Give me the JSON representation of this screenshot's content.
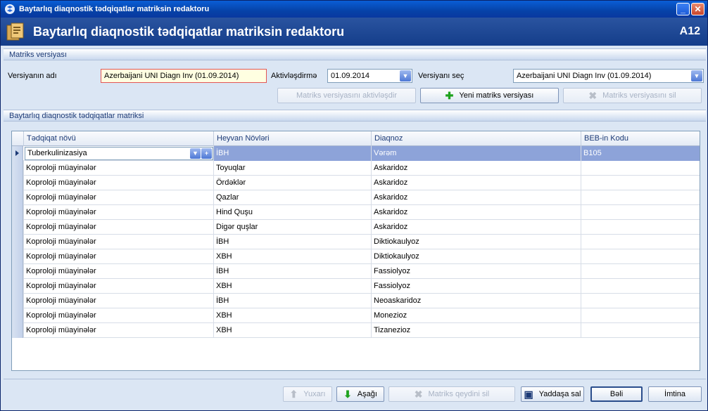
{
  "window": {
    "title": "Baytarlıq diaqnostik tədqiqatlar matriksin redaktoru"
  },
  "banner": {
    "title": "Baytarlıq diaqnostik tədqiqatlar matriksin redaktoru",
    "code": "A12"
  },
  "version_group": {
    "header": "Matriks versiyası",
    "name_label": "Versiyanın adı",
    "name_value": "Azerbaijani UNI Diagn Inv (01.09.2014)",
    "activation_label": "Aktivləşdirmə",
    "activation_value": "01.09.2014",
    "select_label": "Versiyanı seç",
    "select_value": "Azerbaijani UNI Diagn Inv (01.09.2014)",
    "btn_activate": "Matriks versiyasını aktivləşdir",
    "btn_new": "Yeni matriks versiyası",
    "btn_delete": "Matriks versiyasını sil"
  },
  "matrix_group": {
    "header": "Baytarlıq diaqnostik tədqiqatlar matriksi"
  },
  "grid": {
    "columns": [
      "Tədqiqat növü",
      "Heyvan Növləri",
      "Diaqnoz",
      "BEB-in Kodu"
    ],
    "rows": [
      [
        "Tuberkulinizasiya",
        "İBH",
        "Vərəm",
        "B105"
      ],
      [
        "Koproloji müayinələr",
        "Toyuqlar",
        "Askaridoz",
        ""
      ],
      [
        "Koproloji müayinələr",
        "Ördəklər",
        "Askaridoz",
        ""
      ],
      [
        "Koproloji müayinələr",
        "Qazlar",
        "Askaridoz",
        ""
      ],
      [
        "Koproloji müayinələr",
        "Hind Quşu",
        "Askaridoz",
        ""
      ],
      [
        "Koproloji müayinələr",
        "Digər quşlar",
        "Askaridoz",
        ""
      ],
      [
        "Koproloji müayinələr",
        "İBH",
        "Diktiokaulyoz",
        ""
      ],
      [
        "Koproloji müayinələr",
        "XBH",
        "Diktiokaulyoz",
        ""
      ],
      [
        "Koproloji müayinələr",
        "İBH",
        "Fassiolyoz",
        ""
      ],
      [
        "Koproloji müayinələr",
        "XBH",
        "Fassiolyoz",
        ""
      ],
      [
        "Koproloji müayinələr",
        "İBH",
        "Neoaskaridoz",
        ""
      ],
      [
        "Koproloji müayinələr",
        "XBH",
        "Monezioz",
        ""
      ],
      [
        "Koproloji müayinələr",
        "XBH",
        "Tizanezioz",
        ""
      ]
    ]
  },
  "footer": {
    "btn_up": "Yuxarı",
    "btn_down": "Aşağı",
    "btn_delete_record": "Matriks qeydini sil",
    "btn_save": "Yaddaşa sal",
    "btn_ok": "Bəli",
    "btn_cancel": "İmtina"
  },
  "colors": {
    "titlebar": "#0642a8",
    "banner": "#1c4690",
    "background": "#dbe6f4",
    "selection": "#8da3d9"
  }
}
